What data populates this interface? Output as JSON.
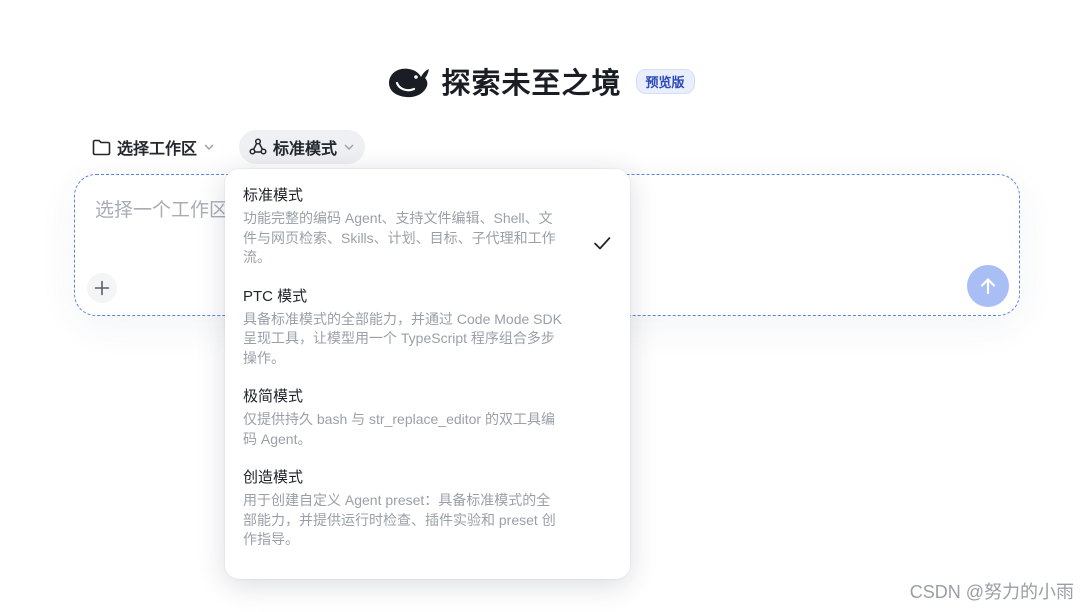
{
  "header": {
    "logo_icon": "whale-logo-icon",
    "title": "探索未至之境",
    "badge": "预览版"
  },
  "toolbar": {
    "workspace_label": "选择工作区",
    "mode_label": "标准模式"
  },
  "input": {
    "placeholder": "选择一个工作区"
  },
  "dropdown": {
    "selected_index": 0,
    "options": [
      {
        "title": "标准模式",
        "desc_lines": [
          "功能完整的编码 Agent、支持文件编辑、Shell、文",
          "件与网页检索、Skills、计划、目标、子代理和工作",
          "流。"
        ]
      },
      {
        "title": "PTC 模式",
        "desc_lines": [
          "具备标准模式的全部能力，并通过 Code Mode SDK",
          "呈现工具，让模型用一个 TypeScript 程序组合多步",
          "操作。"
        ]
      },
      {
        "title": "极简模式",
        "desc_lines": [
          "仅提供持久 bash 与 str_replace_editor 的双工具编",
          "码 Agent。"
        ]
      },
      {
        "title": "创造模式",
        "desc_lines": [
          "用于创建自定义 Agent preset：具备标准模式的全",
          "部能力，并提供运行时检查、插件实验和 preset 创",
          "作指导。"
        ]
      }
    ]
  },
  "watermark": "CSDN @努力的小雨",
  "colors": {
    "accent": "#5b86e0",
    "send_button": "#a9bef5",
    "badge_bg": "#e8eefb",
    "badge_text": "#2b4bb8"
  }
}
